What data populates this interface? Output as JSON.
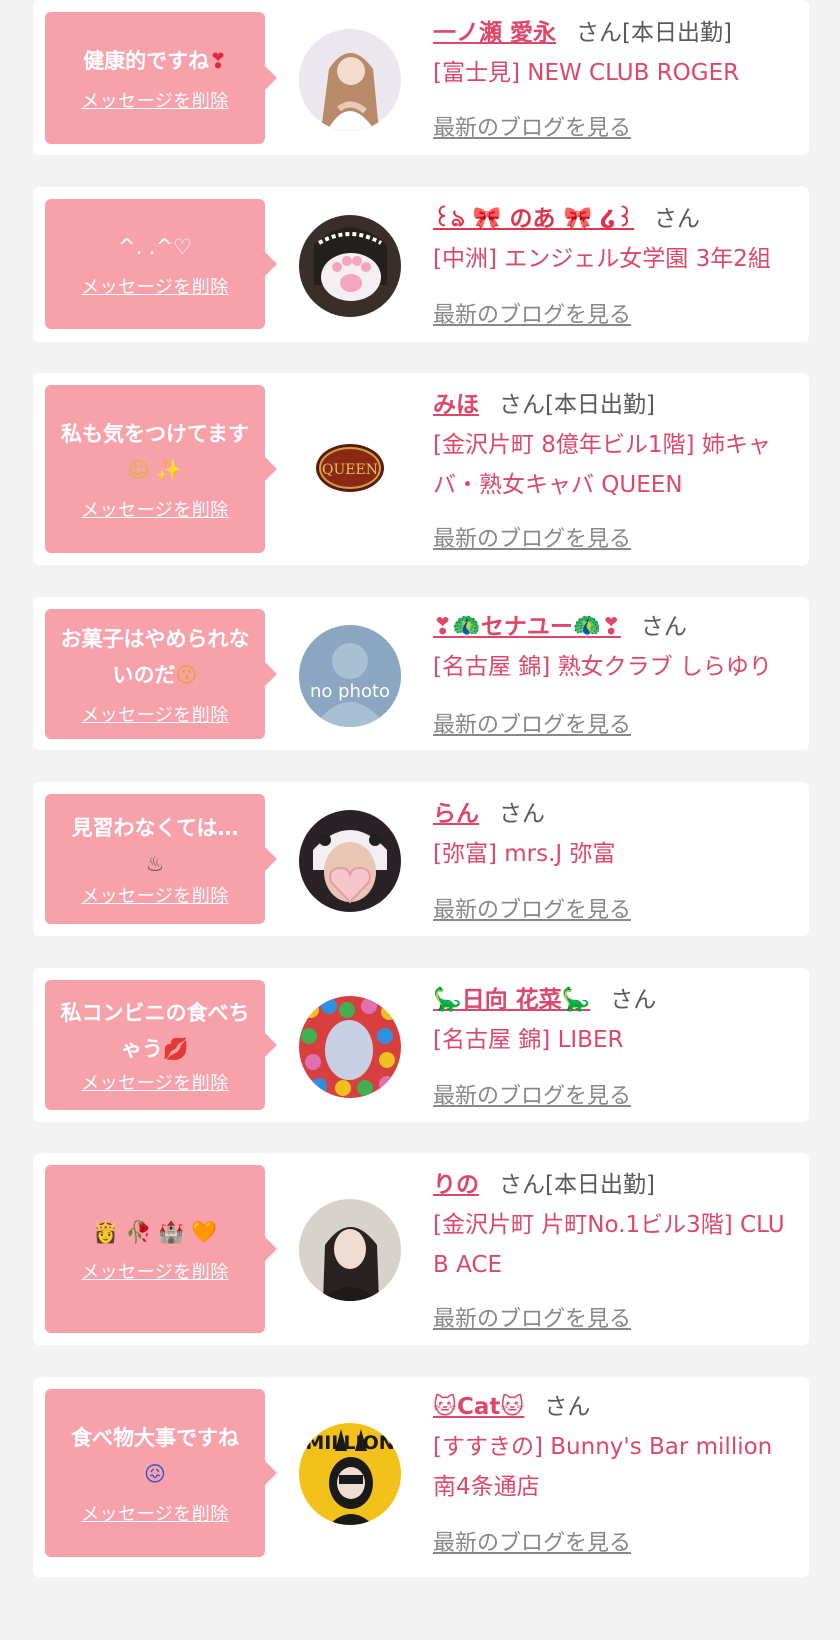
{
  "blog_link_label": "最新のブログを見る",
  "delete_label": "メッセージを削除",
  "san_label": "さん",
  "entries": [
    {
      "message": "健康的ですね",
      "message_emoji": "❣",
      "name": "一ノ瀬 愛永",
      "status": "[本日出勤]",
      "shop": "[富士見] NEW CLUB ROGER",
      "avatar_icon": "woman-photo-icon"
    },
    {
      "message": "^. .^♡",
      "message_emoji": "",
      "name": "꒰ঌ 🎀 のあ 🎀 ໒꒱",
      "status": "",
      "shop": "[中洲] エンジェル女学園 3年2組",
      "avatar_icon": "cat-paw-photo-icon"
    },
    {
      "message": "私も気をつけてます",
      "message_emoji": "☺ ✨",
      "name": "みほ",
      "status": "[本日出勤]",
      "shop": "[金沢片町 8億年ビル1階] 姉キャバ・熟女キャバ QUEEN",
      "avatar_icon": "queen-logo-icon"
    },
    {
      "message": "お菓子はやめられないのだ",
      "message_emoji": "😗",
      "name": "❣🦚セナユー🦚❣",
      "status": "",
      "shop": "[名古屋 錦] 熟女クラブ しらゆり",
      "avatar_icon": "no-photo-icon",
      "avatar_text": "no photo"
    },
    {
      "message": "見習わなくては…",
      "message_emoji": "♨",
      "name": "らん",
      "status": "",
      "shop": "[弥富] mrs.J 弥富",
      "avatar_icon": "heart-mask-photo-icon"
    },
    {
      "message": "私コンビニの食べちゃう",
      "message_emoji": "💋",
      "name": "🦕日向 花菜🦕",
      "status": "",
      "shop": "[名古屋 錦] LIBER",
      "avatar_icon": "ball-pit-photo-icon"
    },
    {
      "message": "",
      "message_emoji": "👸 🥀 🏰 🧡",
      "name": "りの",
      "status": "[本日出勤]",
      "shop": "[金沢片町 片町No.1ビル3階] CLUB ACE",
      "avatar_icon": "woman-photo-icon"
    },
    {
      "message": "食べ物大事ですね",
      "message_emoji": "😖",
      "name": "🐱Cat🐱",
      "status": "",
      "shop": "[すすきの] Bunny's Bar million 南4条通店",
      "avatar_icon": "magazine-cover-icon",
      "avatar_text": "MILLION"
    }
  ]
}
